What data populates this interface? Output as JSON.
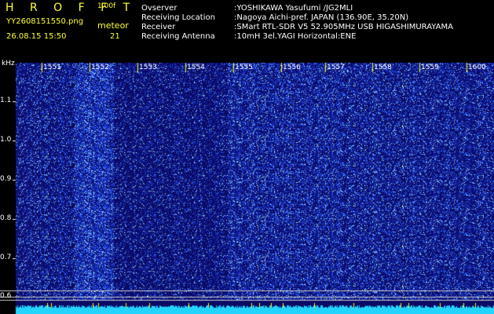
{
  "header": {
    "brand": "H R O F F T",
    "version": "1.00f",
    "filename": "YY2608151550.png",
    "mode_label": "meteor",
    "datetime": "26.08.15 15:50",
    "count": "21",
    "info": [
      {
        "label": "Ovserver",
        "value": ":YOSHIKAWA Yasufumi /JG2MLI"
      },
      {
        "label": "Receiving Location",
        "value": ":Nagoya Aichi-pref. JAPAN (136.90E, 35.20N)"
      },
      {
        "label": "Receiver",
        "value": ":SMart RTL-SDR V5 52.905MHz USB HIGASHIMURAYAMA"
      },
      {
        "label": "Receiving Antenna",
        "value": ":10mH 3el.YAGI Horizontal:ENE"
      }
    ]
  },
  "spectrogram": {
    "y_unit": "kHz",
    "y_ticks": [
      "1.1",
      "1.0",
      "0.9",
      "0.8",
      "0.7",
      "0.6"
    ],
    "x_ticks": [
      "1551",
      "1552",
      "1553",
      "1554",
      "1555",
      "1556",
      "1557",
      "1558",
      "1559",
      "1600"
    ],
    "colors": {
      "background": "#0a0a6a",
      "noise": "#3a5cff",
      "baseline": "#33ccff",
      "marker": "#ffff00"
    }
  }
}
